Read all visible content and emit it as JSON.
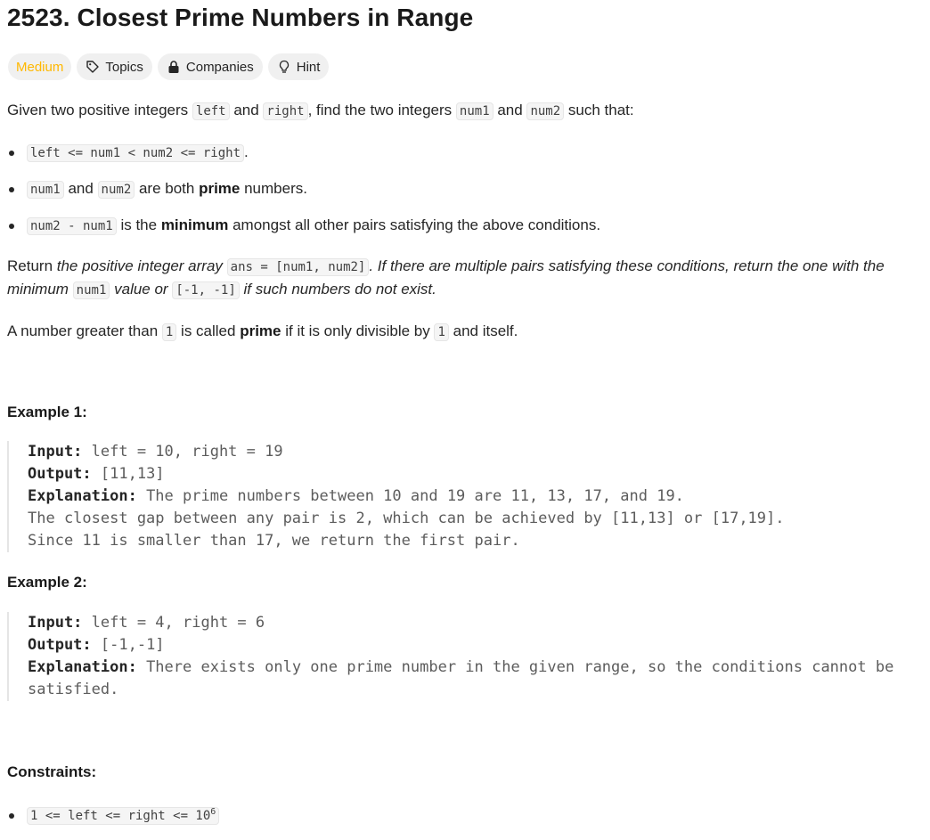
{
  "title": "2523. Closest Prime Numbers in Range",
  "tags": {
    "difficulty": "Medium",
    "topics": "Topics",
    "companies": "Companies",
    "hint": "Hint",
    "difficulty_color": "#ffb800"
  },
  "intro": {
    "t1": "Given two positive integers ",
    "c1": "left",
    "t2": " and ",
    "c2": "right",
    "t3": ", find the two integers ",
    "c3": "num1",
    "t4": " and ",
    "c4": "num2",
    "t5": " such that:"
  },
  "conditions": {
    "b1": {
      "code": "left <= num1 < num2 <= right",
      "tail": "."
    },
    "b2": {
      "c1": "num1",
      "t1": " and ",
      "c2": "num2",
      "t2": " are both ",
      "bold": "prime",
      "t3": " numbers."
    },
    "b3": {
      "code": "num2 - num1",
      "t1": " is the ",
      "bold": "minimum",
      "t2": " amongst all other pairs satisfying the above conditions."
    }
  },
  "return_text": {
    "t1": "Return ",
    "i1": "the positive integer array ",
    "c1": "ans = [num1, num2]",
    "i2": ". If there are multiple pairs satisfying these conditions, return the one with the",
    "i3": "minimum ",
    "c2": "num1",
    "i4": " value or ",
    "c3": "[-1, -1]",
    "i5": " if such numbers do not exist."
  },
  "prime_def": {
    "t1": "A number greater than ",
    "c1": "1",
    "t2": " is called ",
    "bold": "prime",
    "t3": " if it is only divisible by ",
    "c2": "1",
    "t4": " and itself."
  },
  "example1": {
    "heading": "Example 1:",
    "input_label": "Input:",
    "input": " left = 10, right = 19",
    "output_label": "Output:",
    "output": " [11,13]",
    "expl_label": "Explanation:",
    "expl1": " The prime numbers between 10 and 19 are 11, 13, 17, and 19.",
    "expl2": "The closest gap between any pair is 2, which can be achieved by [11,13] or [17,19].",
    "expl3": "Since 11 is smaller than 17, we return the first pair."
  },
  "example2": {
    "heading": "Example 2:",
    "input_label": "Input:",
    "input": " left = 4, right = 6",
    "output_label": "Output:",
    "output": " [-1,-1]",
    "expl_label": "Explanation:",
    "expl1": " There exists only one prime number in the given range, so the conditions cannot be",
    "expl2": "satisfied."
  },
  "constraints": {
    "heading": "Constraints:",
    "c1": "1 <= left <= right <= 10",
    "c1_sup": "6"
  }
}
